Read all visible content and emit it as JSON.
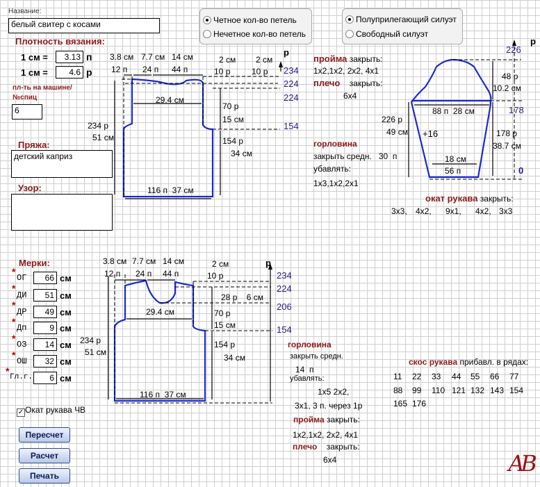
{
  "name_label": "Название:",
  "name_value": "белый свитер с косами",
  "density_title": "Плотность вязания:",
  "density": [
    {
      "lhs": "1 см =",
      "value": "3.13",
      "unit": "п"
    },
    {
      "lhs": "1 см =",
      "value": "4.6",
      "unit": "р"
    }
  ],
  "machine_label_1": "пл-ть на машине/",
  "machine_label_2": "№спиц",
  "machine_value": "6",
  "yarn_title": "Пряжа:",
  "yarn_value": "детский каприз",
  "pattern_title": "Узор:",
  "pattern_value": "",
  "stitch_options": [
    {
      "label": "Четное кол-во петель",
      "selected": true
    },
    {
      "label": "Нечетное кол-во петель",
      "selected": false
    }
  ],
  "fit_options": [
    {
      "label": "Полуприлегающий силуэт",
      "selected": true
    },
    {
      "label": "Свободный силуэт",
      "selected": false
    }
  ],
  "top_diagram": {
    "p_label": "р",
    "dims": [
      "3.8",
      "см",
      "7.7",
      "см",
      "14",
      "см",
      "2",
      "см",
      "2",
      "см"
    ],
    "stitches": [
      "12",
      "п",
      "24",
      "п",
      "44",
      "п",
      "10",
      "р",
      "10",
      "р"
    ],
    "row_marks": [
      "234",
      "224",
      "224",
      "154"
    ],
    "mid_width": [
      "29.4",
      "см"
    ],
    "armhole_rows": [
      "70",
      "р",
      "15",
      "см"
    ],
    "body_rows": [
      "154",
      "р",
      "34",
      "см"
    ],
    "total_rows": [
      "234",
      "р",
      "51",
      "см"
    ],
    "bottom": [
      "116",
      "п",
      "37",
      "см"
    ]
  },
  "armhole_block": {
    "title": "пройма",
    "close": "закрыть:",
    "seq": "1х2,1х2,  2х2,  4х1",
    "shoulder_title": "плечо",
    "shoulder_close": "закрыть:",
    "shoulder_seq": "6х4"
  },
  "neck_block": {
    "title": "горловина",
    "close_mid": "закрыть средн.",
    "close_val": "30",
    "close_unit": "п",
    "decrease": "убавлять:",
    "seq": "1х3,1х2,2х1"
  },
  "sleeve_diagram": {
    "top_num": "226",
    "p_label": "р",
    "cap_rows": [
      "48",
      "р",
      "10.2",
      "см"
    ],
    "mark_178": "178",
    "mark_0": "0",
    "width": [
      "88",
      "п",
      "28",
      "см"
    ],
    "left_rows": [
      "226",
      "р",
      "49",
      "см"
    ],
    "inc": "+16",
    "right_rows": [
      "178",
      "р",
      "38.7",
      "см"
    ],
    "cuff": [
      "18",
      "см",
      "56",
      "п"
    ]
  },
  "sleeve_cap": {
    "title": "окат рукава",
    "close": "закрыть:",
    "seq": [
      "3х3,",
      "4х2,",
      "9х1,",
      "4х2,",
      "3х3"
    ]
  },
  "measures": {
    "title": "Мерки:",
    "items": [
      {
        "code": "ОГ",
        "value": "66",
        "unit": "см"
      },
      {
        "code": "ДИ",
        "value": "51",
        "unit": "см"
      },
      {
        "code": "ДР",
        "value": "49",
        "unit": "см"
      },
      {
        "code": "Дп",
        "value": "9",
        "unit": "см"
      },
      {
        "code": "ОЗ",
        "value": "14",
        "unit": "см"
      },
      {
        "code": "ОШ",
        "value": "32",
        "unit": "см"
      },
      {
        "code": "Гл.г.",
        "value": "6",
        "unit": "см"
      }
    ]
  },
  "bottom_diagram": {
    "p_label": "р",
    "dims": [
      "3.8",
      "см",
      "7.7",
      "см",
      "14",
      "см",
      "2",
      "см"
    ],
    "stitches": [
      "12",
      "п",
      "24",
      "п",
      "44",
      "п",
      "10",
      "р"
    ],
    "row_marks": [
      "234",
      "224",
      "206",
      "154"
    ],
    "neck_rows": [
      "28",
      "р",
      "6",
      "см"
    ],
    "mid_width": [
      "29.4",
      "см"
    ],
    "armhole_rows": [
      "70",
      "р",
      "15",
      "см"
    ],
    "body_rows": [
      "154",
      "р",
      "34",
      "см"
    ],
    "total_rows": [
      "234",
      "р",
      "51",
      "см"
    ],
    "bottom": [
      "116",
      "п",
      "37",
      "см"
    ]
  },
  "front_neck_block": {
    "title": "горловина",
    "close_mid": "закрыть средн.",
    "close_val": "14",
    "close_unit": "п",
    "decrease": "убавлять:",
    "seq1": "1х5 2х2,",
    "seq2": "3х1, 3 п. через 1р"
  },
  "front_armhole": {
    "title": "пройма",
    "close": "закрыть:",
    "seq": "1х2,1х2,  2х2,  4х1",
    "shoulder_title": "плечо",
    "shoulder_close": "закрыть:",
    "shoulder_seq": "6х4"
  },
  "sleeve_slope": {
    "title": "скос рукава",
    "subtitle": "прибавл. в рядах:",
    "rows": [
      [
        "11",
        "22",
        "33",
        "44",
        "55",
        "66",
        "77"
      ],
      [
        "88",
        "99",
        "110",
        "121",
        "132",
        "143",
        "154"
      ],
      [
        "165",
        "176"
      ]
    ]
  },
  "checkbox_label": "Окат рукава ЧВ",
  "checkbox_checked": true,
  "buttons": {
    "recalc": "Пересчет",
    "calc": "Расчет",
    "print": "Печать"
  },
  "logo_text": "АВ",
  "colors": {
    "accent_red": "#8b1a1a",
    "pattern_blue": "#1a2acc",
    "purple": "#2a1a8a"
  }
}
